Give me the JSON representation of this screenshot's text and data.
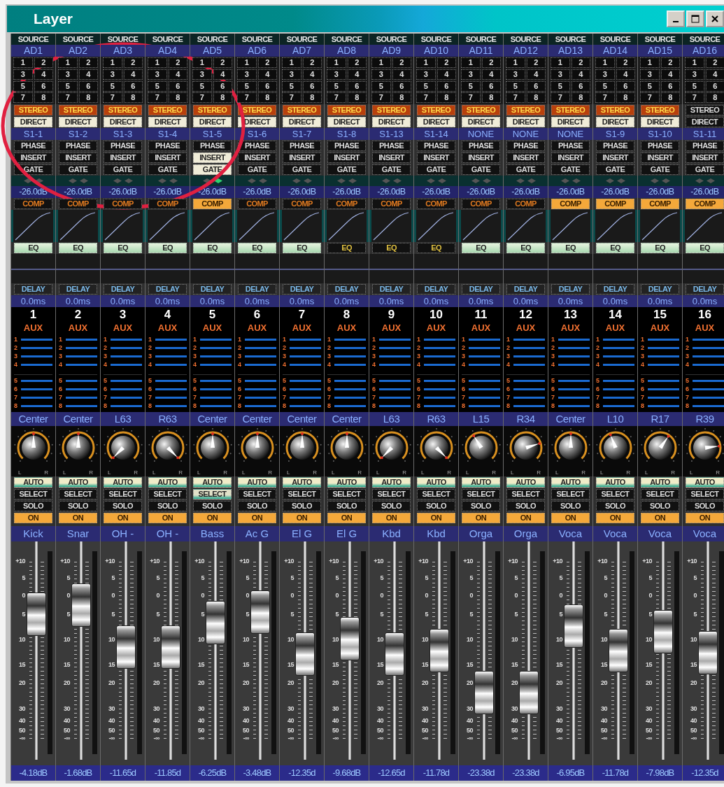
{
  "window": {
    "title": "Layer"
  },
  "annotation": {
    "kind": "ellipse"
  },
  "channels": [
    {
      "source_caption": "SOURCE",
      "source": "AD1",
      "bus": [
        "1",
        "2",
        "3",
        "4",
        "5",
        "6",
        "7",
        "8"
      ],
      "stereo": {
        "label": "STEREO",
        "on": true
      },
      "direct": {
        "label": "DIRECT",
        "on": true
      },
      "patch": "S1-1",
      "phase": {
        "label": "PHASE",
        "on": false
      },
      "insert": {
        "label": "INSERT",
        "on": false
      },
      "gate": {
        "label": "GATE",
        "on": false
      },
      "leds": [
        {
          "on": false
        },
        {
          "on": false
        }
      ],
      "gain": "-26.0dB",
      "comp": {
        "label": "COMP",
        "on": false
      },
      "eq": {
        "label": "EQ",
        "on": true
      },
      "delay": {
        "label": "DELAY"
      },
      "delay_time": "0.0ms",
      "number": "1",
      "aux_label": "AUX",
      "aux_numbers": [
        "1",
        "2",
        "3",
        "4",
        "5",
        "6",
        "7",
        "8"
      ],
      "pan": "Center",
      "knob": {
        "level": 0.5
      },
      "pan_scale": [
        "L",
        "R"
      ],
      "auto": {
        "label": "AUTO",
        "on": true
      },
      "select": {
        "label": "SELECT",
        "on": false
      },
      "solo": {
        "label": "SOLO",
        "on": false
      },
      "on": {
        "label": "ON",
        "on": true
      },
      "name": "Kick",
      "fader_scale": [
        "+10",
        "5",
        "0",
        "5",
        "10",
        "15",
        "20",
        "30",
        "40",
        "50",
        "-∞"
      ],
      "fader": {
        "level": 0.71
      },
      "reading": "-4.18dB"
    },
    {
      "source_caption": "SOURCE",
      "source": "AD2",
      "bus": [
        "1",
        "2",
        "3",
        "4",
        "5",
        "6",
        "7",
        "8"
      ],
      "stereo": {
        "label": "STEREO",
        "on": true
      },
      "direct": {
        "label": "DIRECT",
        "on": true
      },
      "patch": "S1-2",
      "phase": {
        "label": "PHASE",
        "on": false
      },
      "insert": {
        "label": "INSERT",
        "on": false
      },
      "gate": {
        "label": "GATE",
        "on": false
      },
      "leds": [
        {
          "on": false
        },
        {
          "on": false
        }
      ],
      "gain": "-26.0dB",
      "comp": {
        "label": "COMP",
        "on": false
      },
      "eq": {
        "label": "EQ",
        "on": true
      },
      "delay": {
        "label": "DELAY"
      },
      "delay_time": "0.0ms",
      "number": "2",
      "aux_label": "AUX",
      "aux_numbers": [
        "1",
        "2",
        "3",
        "4",
        "5",
        "6",
        "7",
        "8"
      ],
      "pan": "Center",
      "knob": {
        "level": 0.5
      },
      "pan_scale": [
        "L",
        "R"
      ],
      "auto": {
        "label": "AUTO",
        "on": true
      },
      "select": {
        "label": "SELECT",
        "on": false
      },
      "solo": {
        "label": "SOLO",
        "on": false
      },
      "on": {
        "label": "ON",
        "on": true
      },
      "name": "Snar",
      "fader_scale": [
        "+10",
        "5",
        "0",
        "5",
        "10",
        "15",
        "20",
        "30",
        "40",
        "50",
        "-∞"
      ],
      "fader": {
        "level": 0.76
      },
      "reading": "-1.68dB"
    },
    {
      "source_caption": "SOURCE",
      "source": "AD3",
      "bus": [
        "1",
        "2",
        "3",
        "4",
        "5",
        "6",
        "7",
        "8"
      ],
      "stereo": {
        "label": "STEREO",
        "on": true
      },
      "direct": {
        "label": "DIRECT",
        "on": true
      },
      "patch": "S1-3",
      "phase": {
        "label": "PHASE",
        "on": false
      },
      "insert": {
        "label": "INSERT",
        "on": false
      },
      "gate": {
        "label": "GATE",
        "on": false
      },
      "leds": [
        {
          "on": false
        },
        {
          "on": false
        }
      ],
      "gain": "-26.0dB",
      "comp": {
        "label": "COMP",
        "on": false
      },
      "eq": {
        "label": "EQ",
        "on": true
      },
      "delay": {
        "label": "DELAY"
      },
      "delay_time": "0.0ms",
      "number": "3",
      "aux_label": "AUX",
      "aux_numbers": [
        "1",
        "2",
        "3",
        "4",
        "5",
        "6",
        "7",
        "8"
      ],
      "pan": "L63",
      "knob": {
        "level": 0.0
      },
      "pan_scale": [
        "L",
        "R"
      ],
      "auto": {
        "label": "AUTO",
        "on": true
      },
      "select": {
        "label": "SELECT",
        "on": false
      },
      "solo": {
        "label": "SOLO",
        "on": false
      },
      "on": {
        "label": "ON",
        "on": true
      },
      "name": "OH -",
      "fader_scale": [
        "+10",
        "5",
        "0",
        "5",
        "10",
        "15",
        "20",
        "30",
        "40",
        "50",
        "-∞"
      ],
      "fader": {
        "level": 0.52
      },
      "reading": "-11.65d"
    },
    {
      "source_caption": "SOURCE",
      "source": "AD4",
      "bus": [
        "1",
        "2",
        "3",
        "4",
        "5",
        "6",
        "7",
        "8"
      ],
      "stereo": {
        "label": "STEREO",
        "on": true
      },
      "direct": {
        "label": "DIRECT",
        "on": true
      },
      "patch": "S1-4",
      "phase": {
        "label": "PHASE",
        "on": false
      },
      "insert": {
        "label": "INSERT",
        "on": false
      },
      "gate": {
        "label": "GATE",
        "on": false
      },
      "leds": [
        {
          "on": false
        },
        {
          "on": false
        }
      ],
      "gain": "-26.0dB",
      "comp": {
        "label": "COMP",
        "on": false
      },
      "eq": {
        "label": "EQ",
        "on": true
      },
      "delay": {
        "label": "DELAY"
      },
      "delay_time": "0.0ms",
      "number": "4",
      "aux_label": "AUX",
      "aux_numbers": [
        "1",
        "2",
        "3",
        "4",
        "5",
        "6",
        "7",
        "8"
      ],
      "pan": "R63",
      "knob": {
        "level": 1.0
      },
      "pan_scale": [
        "L",
        "R"
      ],
      "auto": {
        "label": "AUTO",
        "on": true
      },
      "select": {
        "label": "SELECT",
        "on": false
      },
      "solo": {
        "label": "SOLO",
        "on": false
      },
      "on": {
        "label": "ON",
        "on": true
      },
      "name": "OH -",
      "fader_scale": [
        "+10",
        "5",
        "0",
        "5",
        "10",
        "15",
        "20",
        "30",
        "40",
        "50",
        "-∞"
      ],
      "fader": {
        "level": 0.52
      },
      "reading": "-11.85d"
    },
    {
      "source_caption": "SOURCE",
      "source": "AD5",
      "bus": [
        "1",
        "2",
        "3",
        "4",
        "5",
        "6",
        "7",
        "8"
      ],
      "stereo": {
        "label": "STEREO",
        "on": true
      },
      "direct": {
        "label": "DIRECT",
        "on": true
      },
      "patch": "S1-5",
      "phase": {
        "label": "PHASE",
        "on": false
      },
      "insert": {
        "label": "INSERT",
        "on": true
      },
      "gate": {
        "label": "GATE",
        "on": true
      },
      "leds": [
        {
          "on": false
        },
        {
          "on": true
        }
      ],
      "gain": "-26.0dB",
      "comp": {
        "label": "COMP",
        "on": true
      },
      "eq": {
        "label": "EQ",
        "on": true
      },
      "delay": {
        "label": "DELAY"
      },
      "delay_time": "0.0ms",
      "number": "5",
      "aux_label": "AUX",
      "aux_numbers": [
        "1",
        "2",
        "3",
        "4",
        "5",
        "6",
        "7",
        "8"
      ],
      "pan": "Center",
      "knob": {
        "level": 0.5
      },
      "pan_scale": [
        "L",
        "R"
      ],
      "auto": {
        "label": "AUTO",
        "on": true
      },
      "select": {
        "label": "SELECT",
        "on": true
      },
      "solo": {
        "label": "SOLO",
        "on": false
      },
      "on": {
        "label": "ON",
        "on": true
      },
      "name": "Bass",
      "fader_scale": [
        "+10",
        "5",
        "0",
        "5",
        "10",
        "15",
        "20",
        "30",
        "40",
        "50",
        "-∞"
      ],
      "fader": {
        "level": 0.66
      },
      "reading": "-6.25dB"
    },
    {
      "source_caption": "SOURCE",
      "source": "AD6",
      "bus": [
        "1",
        "2",
        "3",
        "4",
        "5",
        "6",
        "7",
        "8"
      ],
      "stereo": {
        "label": "STEREO",
        "on": true
      },
      "direct": {
        "label": "DIRECT",
        "on": true
      },
      "patch": "S1-6",
      "phase": {
        "label": "PHASE",
        "on": false
      },
      "insert": {
        "label": "INSERT",
        "on": false
      },
      "gate": {
        "label": "GATE",
        "on": false
      },
      "leds": [
        {
          "on": false
        },
        {
          "on": false
        }
      ],
      "gain": "-26.0dB",
      "comp": {
        "label": "COMP",
        "on": false
      },
      "eq": {
        "label": "EQ",
        "on": true
      },
      "delay": {
        "label": "DELAY"
      },
      "delay_time": "0.0ms",
      "number": "6",
      "aux_label": "AUX",
      "aux_numbers": [
        "1",
        "2",
        "3",
        "4",
        "5",
        "6",
        "7",
        "8"
      ],
      "pan": "Center",
      "knob": {
        "level": 0.5
      },
      "pan_scale": [
        "L",
        "R"
      ],
      "auto": {
        "label": "AUTO",
        "on": true
      },
      "select": {
        "label": "SELECT",
        "on": false
      },
      "solo": {
        "label": "SOLO",
        "on": false
      },
      "on": {
        "label": "ON",
        "on": true
      },
      "name": "Ac G",
      "fader_scale": [
        "+10",
        "5",
        "0",
        "5",
        "10",
        "15",
        "20",
        "30",
        "40",
        "50",
        "-∞"
      ],
      "fader": {
        "level": 0.72
      },
      "reading": "-3.48dB"
    },
    {
      "source_caption": "SOURCE",
      "source": "AD7",
      "bus": [
        "1",
        "2",
        "3",
        "4",
        "5",
        "6",
        "7",
        "8"
      ],
      "stereo": {
        "label": "STEREO",
        "on": true
      },
      "direct": {
        "label": "DIRECT",
        "on": true
      },
      "patch": "S1-7",
      "phase": {
        "label": "PHASE",
        "on": false
      },
      "insert": {
        "label": "INSERT",
        "on": false
      },
      "gate": {
        "label": "GATE",
        "on": false
      },
      "leds": [
        {
          "on": false
        },
        {
          "on": false
        }
      ],
      "gain": "-26.0dB",
      "comp": {
        "label": "COMP",
        "on": false
      },
      "eq": {
        "label": "EQ",
        "on": true
      },
      "delay": {
        "label": "DELAY"
      },
      "delay_time": "0.0ms",
      "number": "7",
      "aux_label": "AUX",
      "aux_numbers": [
        "1",
        "2",
        "3",
        "4",
        "5",
        "6",
        "7",
        "8"
      ],
      "pan": "Center",
      "knob": {
        "level": 0.5
      },
      "pan_scale": [
        "L",
        "R"
      ],
      "auto": {
        "label": "AUTO",
        "on": true
      },
      "select": {
        "label": "SELECT",
        "on": false
      },
      "solo": {
        "label": "SOLO",
        "on": false
      },
      "on": {
        "label": "ON",
        "on": true
      },
      "name": "El G",
      "fader_scale": [
        "+10",
        "5",
        "0",
        "5",
        "10",
        "15",
        "20",
        "30",
        "40",
        "50",
        "-∞"
      ],
      "fader": {
        "level": 0.48
      },
      "reading": "-12.35d"
    },
    {
      "source_caption": "SOURCE",
      "source": "AD8",
      "bus": [
        "1",
        "2",
        "3",
        "4",
        "5",
        "6",
        "7",
        "8"
      ],
      "stereo": {
        "label": "STEREO",
        "on": true
      },
      "direct": {
        "label": "DIRECT",
        "on": true
      },
      "patch": "S1-8",
      "phase": {
        "label": "PHASE",
        "on": false
      },
      "insert": {
        "label": "INSERT",
        "on": false
      },
      "gate": {
        "label": "GATE",
        "on": false
      },
      "leds": [
        {
          "on": false
        },
        {
          "on": false
        }
      ],
      "gain": "-26.0dB",
      "comp": {
        "label": "COMP",
        "on": false
      },
      "eq": {
        "label": "EQ",
        "on": false
      },
      "delay": {
        "label": "DELAY"
      },
      "delay_time": "0.0ms",
      "number": "8",
      "aux_label": "AUX",
      "aux_numbers": [
        "1",
        "2",
        "3",
        "4",
        "5",
        "6",
        "7",
        "8"
      ],
      "pan": "Center",
      "knob": {
        "level": 0.5
      },
      "pan_scale": [
        "L",
        "R"
      ],
      "auto": {
        "label": "AUTO",
        "on": true
      },
      "select": {
        "label": "SELECT",
        "on": false
      },
      "solo": {
        "label": "SOLO",
        "on": false
      },
      "on": {
        "label": "ON",
        "on": true
      },
      "name": "El G",
      "fader_scale": [
        "+10",
        "5",
        "0",
        "5",
        "10",
        "15",
        "20",
        "30",
        "40",
        "50",
        "-∞"
      ],
      "fader": {
        "level": 0.57
      },
      "reading": "-9.68dB"
    },
    {
      "source_caption": "SOURCE",
      "source": "AD9",
      "bus": [
        "1",
        "2",
        "3",
        "4",
        "5",
        "6",
        "7",
        "8"
      ],
      "stereo": {
        "label": "STEREO",
        "on": true
      },
      "direct": {
        "label": "DIRECT",
        "on": true
      },
      "patch": "S1-13",
      "phase": {
        "label": "PHASE",
        "on": false
      },
      "insert": {
        "label": "INSERT",
        "on": false
      },
      "gate": {
        "label": "GATE",
        "on": false
      },
      "leds": [
        {
          "on": false
        },
        {
          "on": false
        }
      ],
      "gain": "-26.0dB",
      "comp": {
        "label": "COMP",
        "on": false
      },
      "eq": {
        "label": "EQ",
        "on": false
      },
      "delay": {
        "label": "DELAY"
      },
      "delay_time": "0.0ms",
      "number": "9",
      "aux_label": "AUX",
      "aux_numbers": [
        "1",
        "2",
        "3",
        "4",
        "5",
        "6",
        "7",
        "8"
      ],
      "pan": "L63",
      "knob": {
        "level": 0.0
      },
      "pan_scale": [
        "L",
        "R"
      ],
      "auto": {
        "label": "AUTO",
        "on": true
      },
      "select": {
        "label": "SELECT",
        "on": false
      },
      "solo": {
        "label": "SOLO",
        "on": false
      },
      "on": {
        "label": "ON",
        "on": true
      },
      "name": "Kbd",
      "fader_scale": [
        "+10",
        "5",
        "0",
        "5",
        "10",
        "15",
        "20",
        "30",
        "40",
        "50",
        "-∞"
      ],
      "fader": {
        "level": 0.48
      },
      "reading": "-12.65d"
    },
    {
      "source_caption": "SOURCE",
      "source": "AD10",
      "bus": [
        "1",
        "2",
        "3",
        "4",
        "5",
        "6",
        "7",
        "8"
      ],
      "stereo": {
        "label": "STEREO",
        "on": true
      },
      "direct": {
        "label": "DIRECT",
        "on": true
      },
      "patch": "S1-14",
      "phase": {
        "label": "PHASE",
        "on": false
      },
      "insert": {
        "label": "INSERT",
        "on": false
      },
      "gate": {
        "label": "GATE",
        "on": false
      },
      "leds": [
        {
          "on": false
        },
        {
          "on": false
        }
      ],
      "gain": "-26.0dB",
      "comp": {
        "label": "COMP",
        "on": false
      },
      "eq": {
        "label": "EQ",
        "on": false
      },
      "delay": {
        "label": "DELAY"
      },
      "delay_time": "0.0ms",
      "number": "10",
      "aux_label": "AUX",
      "aux_numbers": [
        "1",
        "2",
        "3",
        "4",
        "5",
        "6",
        "7",
        "8"
      ],
      "pan": "R63",
      "knob": {
        "level": 1.0
      },
      "pan_scale": [
        "L",
        "R"
      ],
      "auto": {
        "label": "AUTO",
        "on": true
      },
      "select": {
        "label": "SELECT",
        "on": false
      },
      "solo": {
        "label": "SOLO",
        "on": false
      },
      "on": {
        "label": "ON",
        "on": true
      },
      "name": "Kbd",
      "fader_scale": [
        "+10",
        "5",
        "0",
        "5",
        "10",
        "15",
        "20",
        "30",
        "40",
        "50",
        "-∞"
      ],
      "fader": {
        "level": 0.5
      },
      "reading": "-11.78d"
    },
    {
      "source_caption": "SOURCE",
      "source": "AD11",
      "bus": [
        "1",
        "2",
        "3",
        "4",
        "5",
        "6",
        "7",
        "8"
      ],
      "stereo": {
        "label": "STEREO",
        "on": true
      },
      "direct": {
        "label": "DIRECT",
        "on": true
      },
      "patch": "NONE",
      "phase": {
        "label": "PHASE",
        "on": false
      },
      "insert": {
        "label": "INSERT",
        "on": false
      },
      "gate": {
        "label": "GATE",
        "on": false
      },
      "leds": [
        {
          "on": false
        },
        {
          "on": false
        }
      ],
      "gain": "-26.0dB",
      "comp": {
        "label": "COMP",
        "on": false
      },
      "eq": {
        "label": "EQ",
        "on": true
      },
      "delay": {
        "label": "DELAY"
      },
      "delay_time": "0.0ms",
      "number": "11",
      "aux_label": "AUX",
      "aux_numbers": [
        "1",
        "2",
        "3",
        "4",
        "5",
        "6",
        "7",
        "8"
      ],
      "pan": "L15",
      "knob": {
        "level": 0.38
      },
      "pan_scale": [
        "L",
        "R"
      ],
      "auto": {
        "label": "AUTO",
        "on": true
      },
      "select": {
        "label": "SELECT",
        "on": false
      },
      "solo": {
        "label": "SOLO",
        "on": false
      },
      "on": {
        "label": "ON",
        "on": true
      },
      "name": "Orga",
      "fader_scale": [
        "+10",
        "5",
        "0",
        "5",
        "10",
        "15",
        "20",
        "30",
        "40",
        "50",
        "-∞"
      ],
      "fader": {
        "level": 0.26
      },
      "reading": "-23.38d"
    },
    {
      "source_caption": "SOURCE",
      "source": "AD12",
      "bus": [
        "1",
        "2",
        "3",
        "4",
        "5",
        "6",
        "7",
        "8"
      ],
      "stereo": {
        "label": "STEREO",
        "on": true
      },
      "direct": {
        "label": "DIRECT",
        "on": true
      },
      "patch": "NONE",
      "phase": {
        "label": "PHASE",
        "on": false
      },
      "insert": {
        "label": "INSERT",
        "on": false
      },
      "gate": {
        "label": "GATE",
        "on": false
      },
      "leds": [
        {
          "on": false
        },
        {
          "on": false
        }
      ],
      "gain": "-26.0dB",
      "comp": {
        "label": "COMP",
        "on": false
      },
      "eq": {
        "label": "EQ",
        "on": true
      },
      "delay": {
        "label": "DELAY"
      },
      "delay_time": "0.0ms",
      "number": "12",
      "aux_label": "AUX",
      "aux_numbers": [
        "1",
        "2",
        "3",
        "4",
        "5",
        "6",
        "7",
        "8"
      ],
      "pan": "R34",
      "knob": {
        "level": 0.77
      },
      "pan_scale": [
        "L",
        "R"
      ],
      "auto": {
        "label": "AUTO",
        "on": true
      },
      "select": {
        "label": "SELECT",
        "on": false
      },
      "solo": {
        "label": "SOLO",
        "on": false
      },
      "on": {
        "label": "ON",
        "on": true
      },
      "name": "Orga",
      "fader_scale": [
        "+10",
        "5",
        "0",
        "5",
        "10",
        "15",
        "20",
        "30",
        "40",
        "50",
        "-∞"
      ],
      "fader": {
        "level": 0.26
      },
      "reading": "-23.38d"
    },
    {
      "source_caption": "SOURCE",
      "source": "AD13",
      "bus": [
        "1",
        "2",
        "3",
        "4",
        "5",
        "6",
        "7",
        "8"
      ],
      "stereo": {
        "label": "STEREO",
        "on": true
      },
      "direct": {
        "label": "DIRECT",
        "on": true
      },
      "patch": "NONE",
      "phase": {
        "label": "PHASE",
        "on": false
      },
      "insert": {
        "label": "INSERT",
        "on": false
      },
      "gate": {
        "label": "GATE",
        "on": false
      },
      "leds": [
        {
          "on": false
        },
        {
          "on": false
        }
      ],
      "gain": "-26.0dB",
      "comp": {
        "label": "COMP",
        "on": true
      },
      "eq": {
        "label": "EQ",
        "on": true
      },
      "delay": {
        "label": "DELAY"
      },
      "delay_time": "0.0ms",
      "number": "13",
      "aux_label": "AUX",
      "aux_numbers": [
        "1",
        "2",
        "3",
        "4",
        "5",
        "6",
        "7",
        "8"
      ],
      "pan": "Center",
      "knob": {
        "level": 0.5
      },
      "pan_scale": [
        "L",
        "R"
      ],
      "auto": {
        "label": "AUTO",
        "on": true
      },
      "select": {
        "label": "SELECT",
        "on": false
      },
      "solo": {
        "label": "SOLO",
        "on": false
      },
      "on": {
        "label": "ON",
        "on": true
      },
      "name": "Voca",
      "fader_scale": [
        "+10",
        "5",
        "0",
        "5",
        "10",
        "15",
        "20",
        "30",
        "40",
        "50",
        "-∞"
      ],
      "fader": {
        "level": 0.64
      },
      "reading": "-6.95dB"
    },
    {
      "source_caption": "SOURCE",
      "source": "AD14",
      "bus": [
        "1",
        "2",
        "3",
        "4",
        "5",
        "6",
        "7",
        "8"
      ],
      "stereo": {
        "label": "STEREO",
        "on": true
      },
      "direct": {
        "label": "DIRECT",
        "on": true
      },
      "patch": "S1-9",
      "phase": {
        "label": "PHASE",
        "on": false
      },
      "insert": {
        "label": "INSERT",
        "on": false
      },
      "gate": {
        "label": "GATE",
        "on": false
      },
      "leds": [
        {
          "on": false
        },
        {
          "on": false
        }
      ],
      "gain": "-26.0dB",
      "comp": {
        "label": "COMP",
        "on": true
      },
      "eq": {
        "label": "EQ",
        "on": true
      },
      "delay": {
        "label": "DELAY"
      },
      "delay_time": "0.0ms",
      "number": "14",
      "aux_label": "AUX",
      "aux_numbers": [
        "1",
        "2",
        "3",
        "4",
        "5",
        "6",
        "7",
        "8"
      ],
      "pan": "L10",
      "knob": {
        "level": 0.42
      },
      "pan_scale": [
        "L",
        "R"
      ],
      "auto": {
        "label": "AUTO",
        "on": true
      },
      "select": {
        "label": "SELECT",
        "on": false
      },
      "solo": {
        "label": "SOLO",
        "on": false
      },
      "on": {
        "label": "ON",
        "on": true
      },
      "name": "Voca",
      "fader_scale": [
        "+10",
        "5",
        "0",
        "5",
        "10",
        "15",
        "20",
        "30",
        "40",
        "50",
        "-∞"
      ],
      "fader": {
        "level": 0.5
      },
      "reading": "-11.78d"
    },
    {
      "source_caption": "SOURCE",
      "source": "AD15",
      "bus": [
        "1",
        "2",
        "3",
        "4",
        "5",
        "6",
        "7",
        "8"
      ],
      "stereo": {
        "label": "STEREO",
        "on": true
      },
      "direct": {
        "label": "DIRECT",
        "on": true
      },
      "patch": "S1-10",
      "phase": {
        "label": "PHASE",
        "on": false
      },
      "insert": {
        "label": "INSERT",
        "on": false
      },
      "gate": {
        "label": "GATE",
        "on": false
      },
      "leds": [
        {
          "on": false
        },
        {
          "on": false
        }
      ],
      "gain": "-26.0dB",
      "comp": {
        "label": "COMP",
        "on": true
      },
      "eq": {
        "label": "EQ",
        "on": true
      },
      "delay": {
        "label": "DELAY"
      },
      "delay_time": "0.0ms",
      "number": "15",
      "aux_label": "AUX",
      "aux_numbers": [
        "1",
        "2",
        "3",
        "4",
        "5",
        "6",
        "7",
        "8"
      ],
      "pan": "R17",
      "knob": {
        "level": 0.63
      },
      "pan_scale": [
        "L",
        "R"
      ],
      "auto": {
        "label": "AUTO",
        "on": true
      },
      "select": {
        "label": "SELECT",
        "on": false
      },
      "solo": {
        "label": "SOLO",
        "on": false
      },
      "on": {
        "label": "ON",
        "on": true
      },
      "name": "Voca",
      "fader_scale": [
        "+10",
        "5",
        "0",
        "5",
        "10",
        "15",
        "20",
        "30",
        "40",
        "50",
        "-∞"
      ],
      "fader": {
        "level": 0.61
      },
      "reading": "-7.98dB"
    },
    {
      "source_caption": "SOURCE",
      "source": "AD16",
      "bus": [
        "1",
        "2",
        "3",
        "4",
        "5",
        "6",
        "7",
        "8"
      ],
      "stereo": {
        "label": "STEREO",
        "on": false
      },
      "direct": {
        "label": "DIRECT",
        "on": false
      },
      "patch": "S1-11",
      "phase": {
        "label": "PHASE",
        "on": false
      },
      "insert": {
        "label": "INSERT",
        "on": false
      },
      "gate": {
        "label": "GATE",
        "on": false
      },
      "leds": [
        {
          "on": false
        },
        {
          "on": false
        }
      ],
      "gain": "-26.0dB",
      "comp": {
        "label": "COMP",
        "on": true
      },
      "eq": {
        "label": "EQ",
        "on": true
      },
      "delay": {
        "label": "DELAY"
      },
      "delay_time": "0.0ms",
      "number": "16",
      "aux_label": "AUX",
      "aux_numbers": [
        "1",
        "2",
        "3",
        "4",
        "5",
        "6",
        "7",
        "8"
      ],
      "pan": "R39",
      "knob": {
        "level": 0.81
      },
      "pan_scale": [
        "L",
        "R"
      ],
      "auto": {
        "label": "AUTO",
        "on": true
      },
      "select": {
        "label": "SELECT",
        "on": false
      },
      "solo": {
        "label": "SOLO",
        "on": false
      },
      "on": {
        "label": "ON",
        "on": true
      },
      "name": "Voca",
      "fader_scale": [
        "+10",
        "5",
        "0",
        "5",
        "10",
        "15",
        "20",
        "30",
        "40",
        "50",
        "-∞"
      ],
      "fader": {
        "level": 0.49
      },
      "reading": "-12.35d"
    }
  ]
}
